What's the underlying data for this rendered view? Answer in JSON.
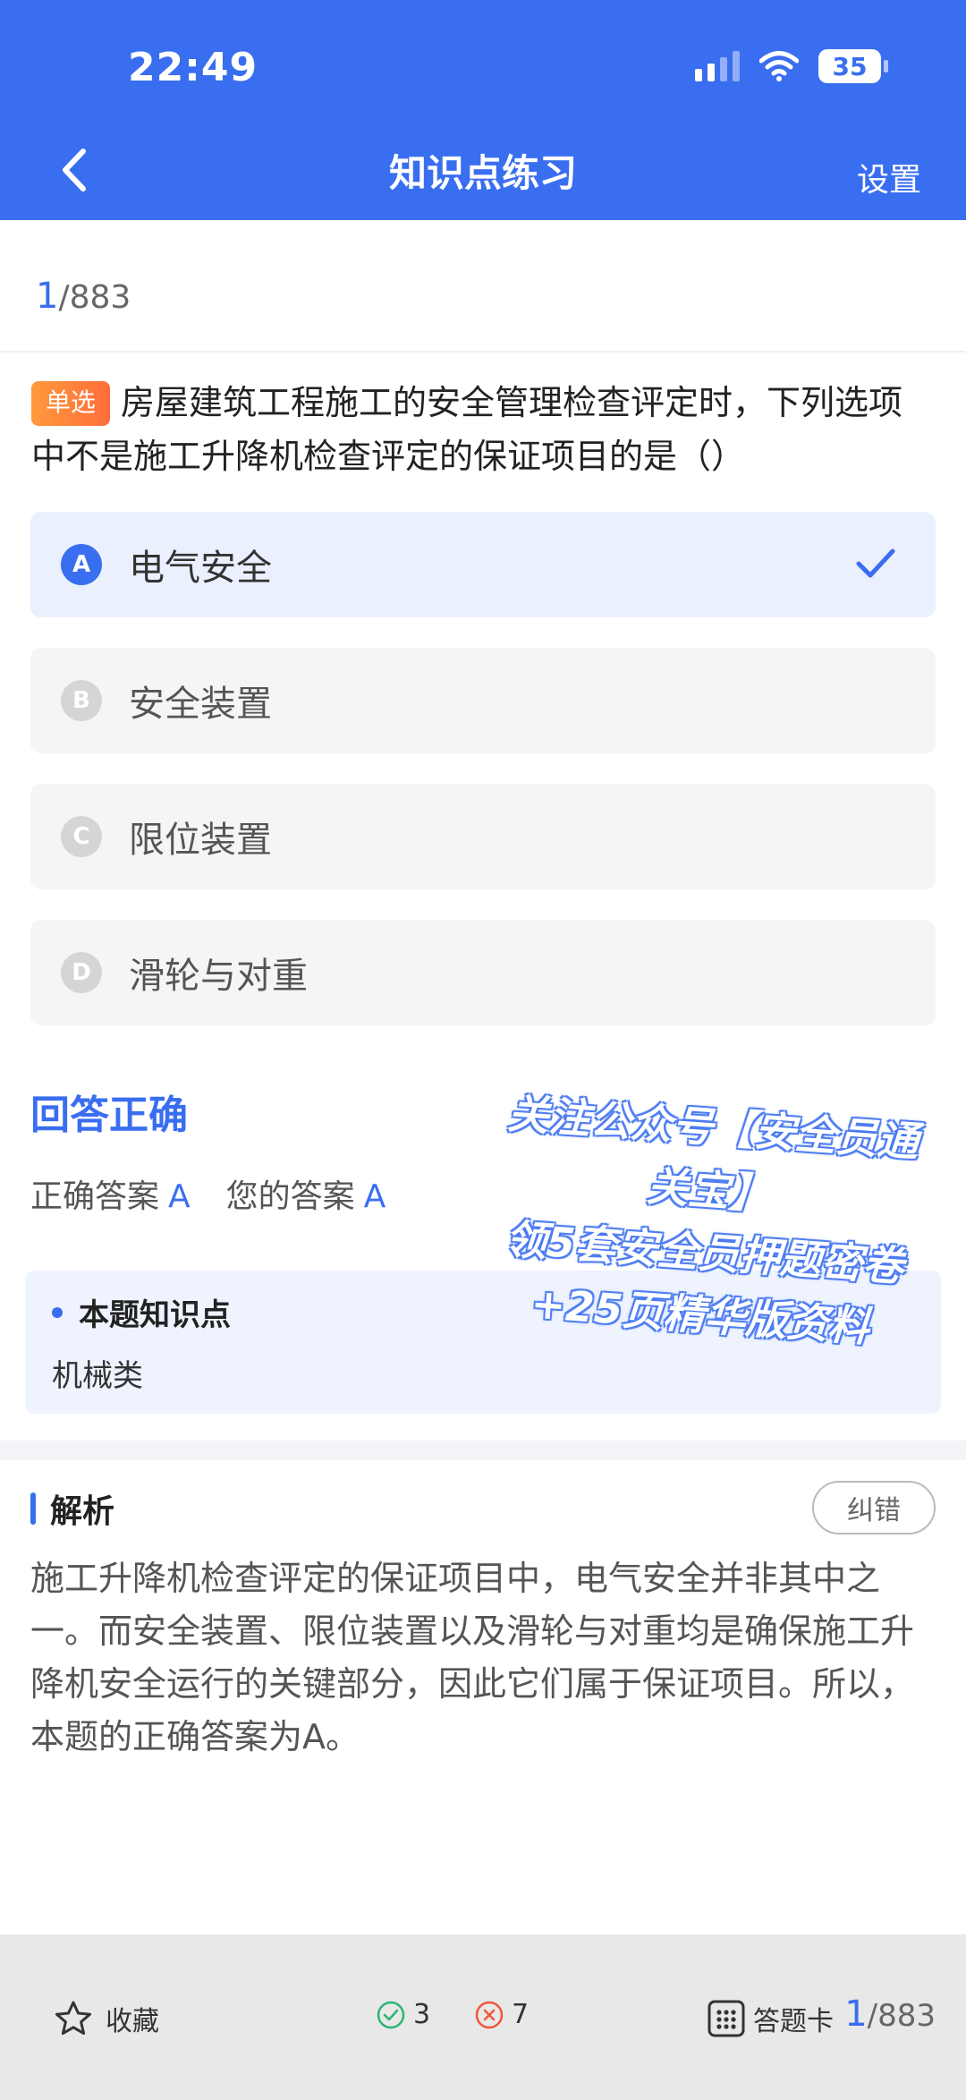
{
  "status_bar": {
    "time": "22:49",
    "battery": "35"
  },
  "nav": {
    "title": "知识点练习",
    "settings": "设置"
  },
  "progress": {
    "current": "1",
    "total": "/883"
  },
  "question": {
    "type_badge": "单选",
    "text": "房屋建筑工程施工的安全管理检查评定时，下列选项中不是施工升降机检查评定的保证项目的是（）"
  },
  "options": [
    {
      "letter": "A",
      "text": "电气安全",
      "selected": true
    },
    {
      "letter": "B",
      "text": "安全装置",
      "selected": false
    },
    {
      "letter": "C",
      "text": "限位装置",
      "selected": false
    },
    {
      "letter": "D",
      "text": "滑轮与对重",
      "selected": false
    }
  ],
  "result": {
    "title": "回答正确",
    "correct_label": "正确答案",
    "correct_value": "A",
    "your_label": "您的答案",
    "your_value": "A"
  },
  "knowledge": {
    "heading": "本题知识点",
    "value": "机械类"
  },
  "watermark": {
    "line1": "关注公众号【安全员通",
    "line2": "关宝】",
    "line3": "领5套安全员押题密卷",
    "line4": "+25页精华版资料"
  },
  "analysis": {
    "heading": "解析",
    "report_button": "纠错",
    "text": "施工升降机检查评定的保证项目中，电气安全并非其中之一。而安全装置、限位装置以及滑轮与对重均是确保施工升降机安全运行的关键部分，因此它们属于保证项目。所以，本题的正确答案为A。"
  },
  "bottom": {
    "favorite": "收藏",
    "right_count": "3",
    "wrong_count": "7",
    "answer_card": "答题卡",
    "current": "1",
    "total": "/883"
  },
  "colors": {
    "accent": "#3A6EF0",
    "badge": "#FF7A3C",
    "correct": "#2BB673",
    "wrong": "#F0573A"
  }
}
